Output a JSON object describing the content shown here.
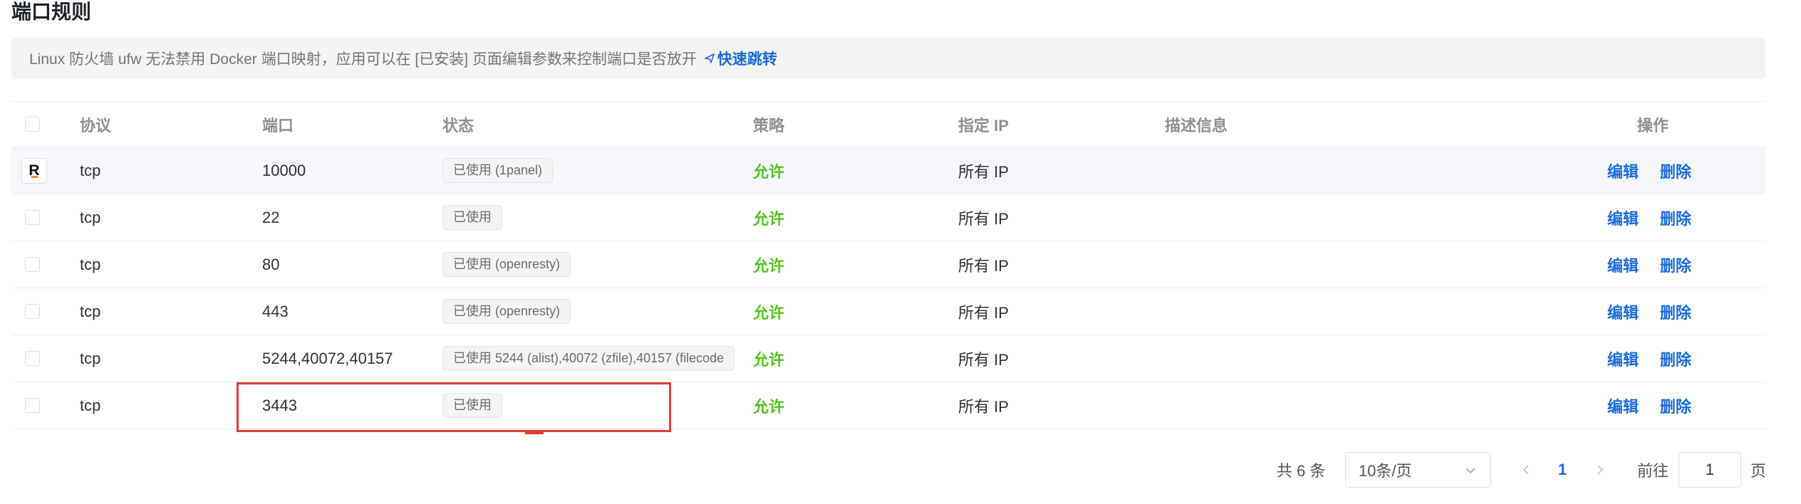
{
  "page": {
    "title": "端口规则"
  },
  "notice": {
    "text": "Linux 防火墙 ufw 无法禁用 Docker 端口映射，应用可以在 [已安装] 页面编辑参数来控制端口是否放开",
    "link": "快速跳转"
  },
  "table": {
    "headers": {
      "protocol": "协议",
      "port": "端口",
      "status": "状态",
      "strategy": "策略",
      "ip": "指定 IP",
      "description": "描述信息",
      "actions": "操作"
    },
    "rows": [
      {
        "protocol": "tcp",
        "port": "10000",
        "status": "已使用 (1panel)",
        "strategy": "允许",
        "ip": "所有 IP",
        "description": "",
        "edit": "编辑",
        "delete": "删除"
      },
      {
        "protocol": "tcp",
        "port": "22",
        "status": "已使用",
        "strategy": "允许",
        "ip": "所有 IP",
        "description": "",
        "edit": "编辑",
        "delete": "删除"
      },
      {
        "protocol": "tcp",
        "port": "80",
        "status": "已使用 (openresty)",
        "strategy": "允许",
        "ip": "所有 IP",
        "description": "",
        "edit": "编辑",
        "delete": "删除"
      },
      {
        "protocol": "tcp",
        "port": "443",
        "status": "已使用 (openresty)",
        "strategy": "允许",
        "ip": "所有 IP",
        "description": "",
        "edit": "编辑",
        "delete": "删除"
      },
      {
        "protocol": "tcp",
        "port": "5244,40072,40157",
        "status": "已使用 5244 (alist),40072 (zfile),40157 (filecode",
        "strategy": "允许",
        "ip": "所有 IP",
        "description": "",
        "edit": "编辑",
        "delete": "删除"
      },
      {
        "protocol": "tcp",
        "port": "3443",
        "status": "已使用",
        "strategy": "允许",
        "ip": "所有 IP",
        "description": "",
        "edit": "编辑",
        "delete": "删除"
      }
    ]
  },
  "pagination": {
    "total": "共 6 条",
    "page_size": "10条/页",
    "current_page": "1",
    "goto_label": "前往",
    "goto_value": "1",
    "page_suffix": "页"
  },
  "colors": {
    "accent": "#1a6be0",
    "allow": "#52c41a",
    "highlight": "#e53935"
  },
  "icons": {
    "row1_logo": "1panel-logo-icon",
    "jump": "send-icon",
    "select": "chevron-down-icon",
    "prev": "chevron-left-icon",
    "next": "chevron-right-icon"
  }
}
